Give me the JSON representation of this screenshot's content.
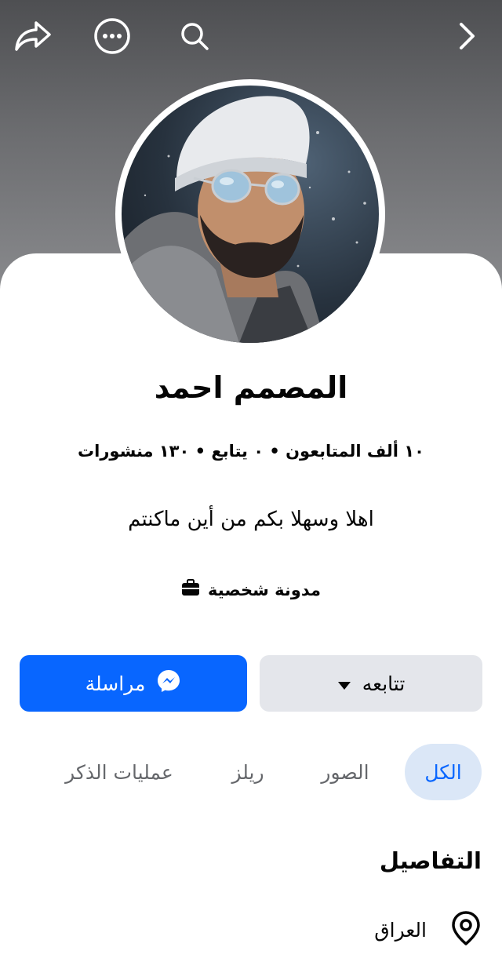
{
  "header": {
    "icons": [
      "back-arrow-icon",
      "search-icon",
      "more-options-icon",
      "share-icon"
    ]
  },
  "profile": {
    "name": "المصمم احمد",
    "stats": "١٠ ألف المتابعون • ٠ يتابع • ١٣٠ منشورات",
    "bio": "اهلا وسهلا بكم من أين ماكنتم",
    "category": "مدونة شخصية"
  },
  "actions": {
    "follow_label": "تتابعه",
    "message_label": "مراسلة"
  },
  "tabs": [
    {
      "label": "الكل",
      "active": true
    },
    {
      "label": "الصور",
      "active": false
    },
    {
      "label": "ريلز",
      "active": false
    },
    {
      "label": "عمليات الذكر",
      "active": false
    }
  ],
  "details": {
    "title": "التفاصيل",
    "location": "العراق"
  },
  "colors": {
    "accent": "#0866ff",
    "active_tab_bg": "#dbe7f7",
    "secondary_button": "#e4e6eb"
  }
}
